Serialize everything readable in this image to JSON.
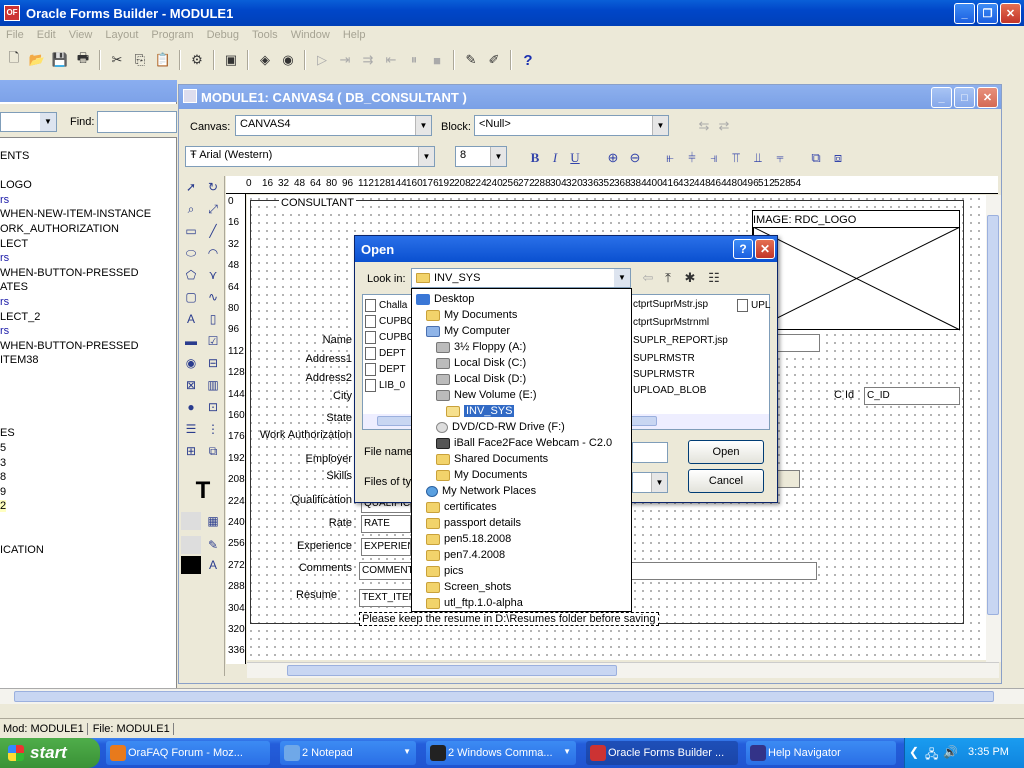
{
  "app": {
    "title": "Oracle Forms Builder - MODULE1",
    "menu": [
      "File",
      "Edit",
      "View",
      "Layout",
      "Program",
      "Debug",
      "Tools",
      "Window",
      "Help"
    ]
  },
  "toolbar": {
    "icons": [
      "new-icon",
      "open-icon",
      "save-icon",
      "print-icon",
      "cut-icon",
      "copy-icon",
      "paste-icon",
      "compile-icon",
      "run-form-icon",
      "run-debug-icon",
      "run-web-icon",
      "step-into-icon",
      "step-over-icon",
      "step-out-icon",
      "pause-icon",
      "stop-icon",
      "wizard-icon",
      "layout-wizard-icon",
      "help-icon"
    ]
  },
  "navigator": {
    "find_label": "Find:",
    "items": [
      {
        "text": "ENTS",
        "style": "normal"
      },
      {
        "text": "",
        "style": "normal"
      },
      {
        "text": "LOGO",
        "style": "normal"
      },
      {
        "text": "rs",
        "style": "blue"
      },
      {
        "text": "WHEN-NEW-ITEM-INSTANCE",
        "style": "normal"
      },
      {
        "text": "ORK_AUTHORIZATION",
        "style": "normal"
      },
      {
        "text": "LECT",
        "style": "normal"
      },
      {
        "text": "rs",
        "style": "blue"
      },
      {
        "text": "WHEN-BUTTON-PRESSED",
        "style": "normal"
      },
      {
        "text": "ATES",
        "style": "normal"
      },
      {
        "text": "rs",
        "style": "blue"
      },
      {
        "text": "LECT_2",
        "style": "normal"
      },
      {
        "text": "rs",
        "style": "blue"
      },
      {
        "text": "WHEN-BUTTON-PRESSED",
        "style": "normal"
      },
      {
        "text": "ITEM38",
        "style": "normal"
      },
      {
        "text": "",
        "style": "normal"
      },
      {
        "text": "",
        "style": "normal"
      },
      {
        "text": "",
        "style": "normal"
      },
      {
        "text": "",
        "style": "normal"
      },
      {
        "text": "ES",
        "style": "normal"
      },
      {
        "text": "5",
        "style": "normal"
      },
      {
        "text": "3",
        "style": "normal"
      },
      {
        "text": "8",
        "style": "normal"
      },
      {
        "text": "9",
        "style": "normal"
      },
      {
        "text": "2",
        "style": "sel"
      },
      {
        "text": "",
        "style": "normal"
      },
      {
        "text": "",
        "style": "normal"
      },
      {
        "text": "ICATION",
        "style": "normal"
      }
    ]
  },
  "canvas_window": {
    "title": "MODULE1: CANVAS4 ( DB_CONSULTANT )",
    "canvas_label": "Canvas:",
    "canvas_value": "CANVAS4",
    "block_label": "Block:",
    "block_value": "<Null>",
    "font_value": "Arial (Western)",
    "font_size": "8",
    "ruler_h": [
      "0",
      "16",
      "32",
      "48",
      "64",
      "80",
      "96",
      "112",
      "128",
      "144",
      "160",
      "176",
      "192",
      "208",
      "224",
      "240",
      "256",
      "272",
      "288",
      "304",
      "320",
      "336",
      "352",
      "368",
      "384",
      "400",
      "416",
      "432",
      "448",
      "464",
      "480",
      "496",
      "512",
      "528",
      "54"
    ],
    "ruler_v": [
      "0",
      "16",
      "32",
      "48",
      "64",
      "80",
      "96",
      "112",
      "128",
      "144",
      "160",
      "176",
      "192",
      "208",
      "224",
      "240",
      "256",
      "272",
      "288",
      "304",
      "320",
      "336"
    ],
    "frame_title": "CONSULTANT",
    "image_label": "IMAGE: RDC_LOGO",
    "labels": {
      "name": "Name",
      "address1": "Address1",
      "address2": "Address2",
      "city": "City",
      "state": "State",
      "work_auth": "Work Authorization",
      "employer": "Employer",
      "skills": "Skills",
      "qualification": "Qualification",
      "rate": "Rate",
      "experience": "Experience",
      "comments": "Comments",
      "resume": "Resume",
      "cid": "C Id"
    },
    "fields": {
      "qualification": "QUALIFIC",
      "rate": "RATE",
      "experience": "EXPERIEN",
      "comments": "COMMENT",
      "resume": "TEXT_ITEM",
      "cid": "C_ID"
    },
    "note": "Please keep the resume in D:\\Resumes folder before saving"
  },
  "open_dialog": {
    "title": "Open",
    "look_in_label": "Look in:",
    "look_in_value": "INV_SYS",
    "file_name_label": "File name",
    "files_of_type_label": "Files of typ",
    "open_button": "Open",
    "cancel_button": "Cancel",
    "files_col1": [
      "Challa",
      "CUPBO",
      "CUPBO",
      "DEPT",
      "DEPT",
      "LIB_0"
    ],
    "files_col2": [
      "ctprtSuprMstr.jsp",
      "ctprtSuprMstrnml",
      "SUPLR_REPORT.jsp",
      "SUPLRMSTR",
      "SUPLRMSTR",
      "UPLOAD_BLOB"
    ],
    "files_col3": [
      "UPL"
    ],
    "dropdown": [
      {
        "text": "Desktop",
        "indent": 0,
        "icon": "desktop"
      },
      {
        "text": "My Documents",
        "indent": 1,
        "icon": "folder"
      },
      {
        "text": "My Computer",
        "indent": 1,
        "icon": "computer"
      },
      {
        "text": "3½ Floppy (A:)",
        "indent": 2,
        "icon": "drive"
      },
      {
        "text": "Local Disk (C:)",
        "indent": 2,
        "icon": "drive"
      },
      {
        "text": "Local Disk (D:)",
        "indent": 2,
        "icon": "drive"
      },
      {
        "text": "New Volume (E:)",
        "indent": 2,
        "icon": "drive"
      },
      {
        "text": "INV_SYS",
        "indent": 3,
        "icon": "folder-open",
        "selected": true
      },
      {
        "text": "DVD/CD-RW Drive (F:)",
        "indent": 2,
        "icon": "cd"
      },
      {
        "text": "iBall Face2Face Webcam - C2.0",
        "indent": 2,
        "icon": "camera"
      },
      {
        "text": "Shared Documents",
        "indent": 2,
        "icon": "folder"
      },
      {
        "text": "My Documents",
        "indent": 2,
        "icon": "folder"
      },
      {
        "text": "My Network Places",
        "indent": 1,
        "icon": "network"
      },
      {
        "text": "certificates",
        "indent": 1,
        "icon": "folder"
      },
      {
        "text": "passport details",
        "indent": 1,
        "icon": "folder"
      },
      {
        "text": "pen5.18.2008",
        "indent": 1,
        "icon": "folder"
      },
      {
        "text": "pen7.4.2008",
        "indent": 1,
        "icon": "folder"
      },
      {
        "text": "pics",
        "indent": 1,
        "icon": "folder"
      },
      {
        "text": "Screen_shots",
        "indent": 1,
        "icon": "folder"
      },
      {
        "text": "utl_ftp.1.0-alpha",
        "indent": 1,
        "icon": "folder"
      }
    ]
  },
  "statusbar": {
    "mod": "Mod: MODULE1",
    "file": "File: MODULE1"
  },
  "taskbar": {
    "start": "start",
    "tasks": [
      {
        "label": "OraFAQ Forum - Moz...",
        "icon_color": "#e87a1c"
      },
      {
        "label": "2 Notepad",
        "icon_color": "#6fa8e8"
      },
      {
        "label": "2 Windows Comma...",
        "icon_color": "#222222"
      },
      {
        "label": "Oracle Forms Builder ...",
        "icon_color": "#cc3333"
      },
      {
        "label": "Help Navigator",
        "icon_color": "#333388"
      }
    ],
    "clock": "3:35 PM"
  }
}
